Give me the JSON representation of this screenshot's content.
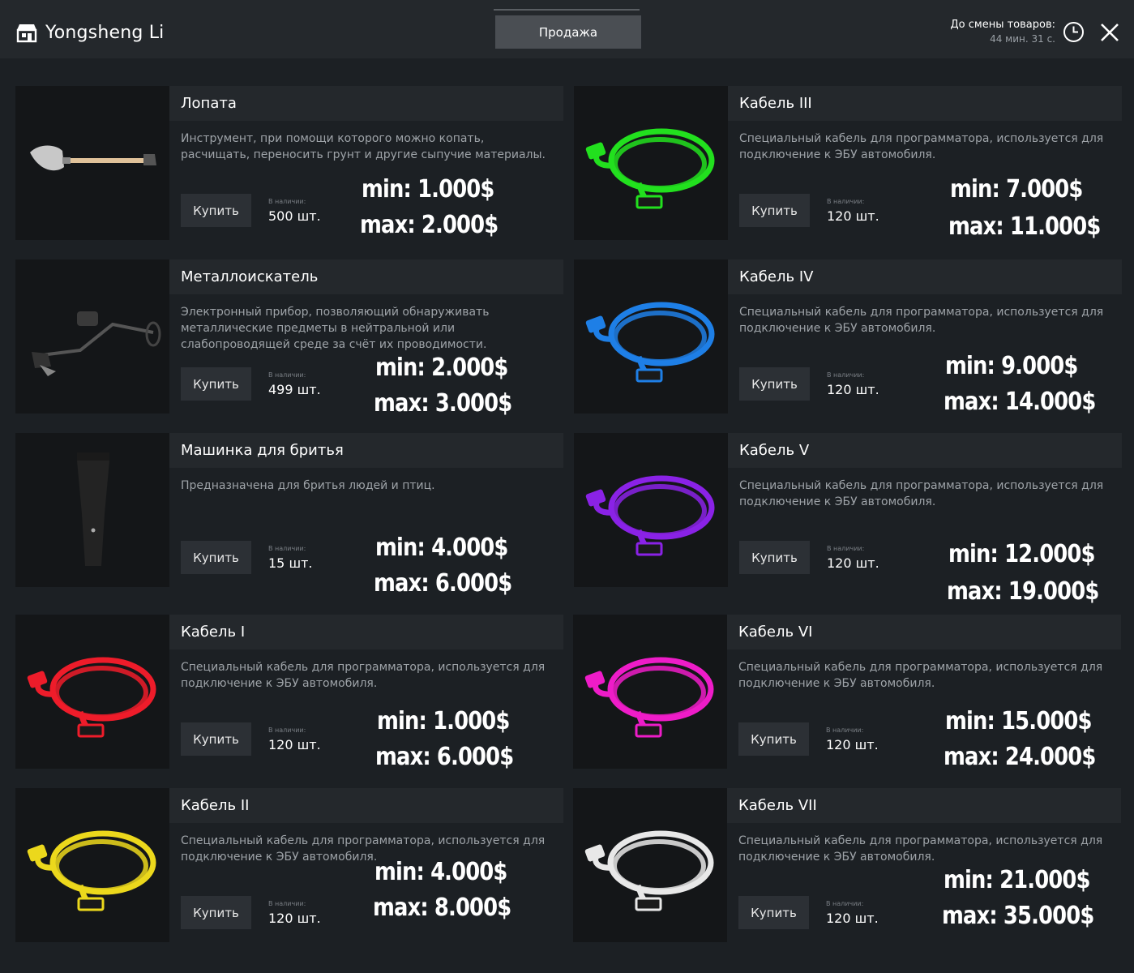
{
  "header": {
    "shop_name": "Yongsheng Li",
    "tab_label": "Продажа",
    "timer_label": "До смены товаров:",
    "timer_value": "44 мин. 31 с."
  },
  "stock_label": "В наличии:",
  "buy_label": "Купить",
  "items": [
    {
      "title": "Лопата",
      "desc": "Инструмент, при помощи которого можно копать, расчищать, переносить грунт и другие сыпучие материалы.",
      "stock": "500 шт.",
      "min": "min: 1.000$",
      "max": "max: 2.000$",
      "image": "shovel",
      "color": "#bfbfbf"
    },
    {
      "title": "Кабель III",
      "desc": "Специальный кабель для программатора, используется для подключение к ЭБУ автомобиля.",
      "stock": "120 шт.",
      "min": "min: 7.000$",
      "max": "max: 11.000$",
      "image": "cable",
      "color": "#22e01e"
    },
    {
      "title": "Металлоискатель",
      "desc": "Электронный прибор, позволяющий обнаруживать металлические предметы в нейтральной или слабопроводящей среде за счёт их проводимости.",
      "stock": "499 шт.",
      "min": "min: 2.000$",
      "max": "max: 3.000$",
      "image": "detector",
      "color": "#3a3a3a"
    },
    {
      "title": "Кабель IV",
      "desc": "Специальный кабель для программатора, используется для подключение к ЭБУ автомобиля.",
      "stock": "120 шт.",
      "min": "min: 9.000$",
      "max": "max: 14.000$",
      "image": "cable",
      "color": "#1e7fe6"
    },
    {
      "title": "Машинка для бритья",
      "desc": "Предназначена для бритья людей и птиц.",
      "stock": "15 шт.",
      "min": "min: 4.000$",
      "max": "max: 6.000$",
      "image": "trimmer",
      "color": "#2a2a2a"
    },
    {
      "title": "Кабель V",
      "desc": "Специальный кабель для программатора, используется для подключение к ЭБУ автомобиля.",
      "stock": "120 шт.",
      "min": "min: 12.000$",
      "max": "max: 19.000$",
      "image": "cable",
      "color": "#8a22e6"
    },
    {
      "title": "Кабель I",
      "desc": "Специальный кабель для программатора, используется для подключение к ЭБУ автомобиля.",
      "stock": "120 шт.",
      "min": "min: 1.000$",
      "max": "max: 6.000$",
      "image": "cable",
      "color": "#ee1c2a"
    },
    {
      "title": "Кабель VI",
      "desc": "Специальный кабель для программатора, используется для подключение к ЭБУ автомобиля.",
      "stock": "120 шт.",
      "min": "min: 15.000$",
      "max": "max: 24.000$",
      "image": "cable",
      "color": "#ee1cc8"
    },
    {
      "title": "Кабель II",
      "desc": "Специальный кабель для программатора, используется для подключение к ЭБУ автомобиля.",
      "stock": "120 шт.",
      "min": "min: 4.000$",
      "max": "max: 8.000$",
      "image": "cable",
      "color": "#ecd81c"
    },
    {
      "title": "Кабель VII",
      "desc": "Специальный кабель для программатора, используется для подключение к ЭБУ автомобиля.",
      "stock": "120 шт.",
      "min": "min: 21.000$",
      "max": "max: 35.000$",
      "image": "cable",
      "color": "#e8e8e8"
    }
  ]
}
